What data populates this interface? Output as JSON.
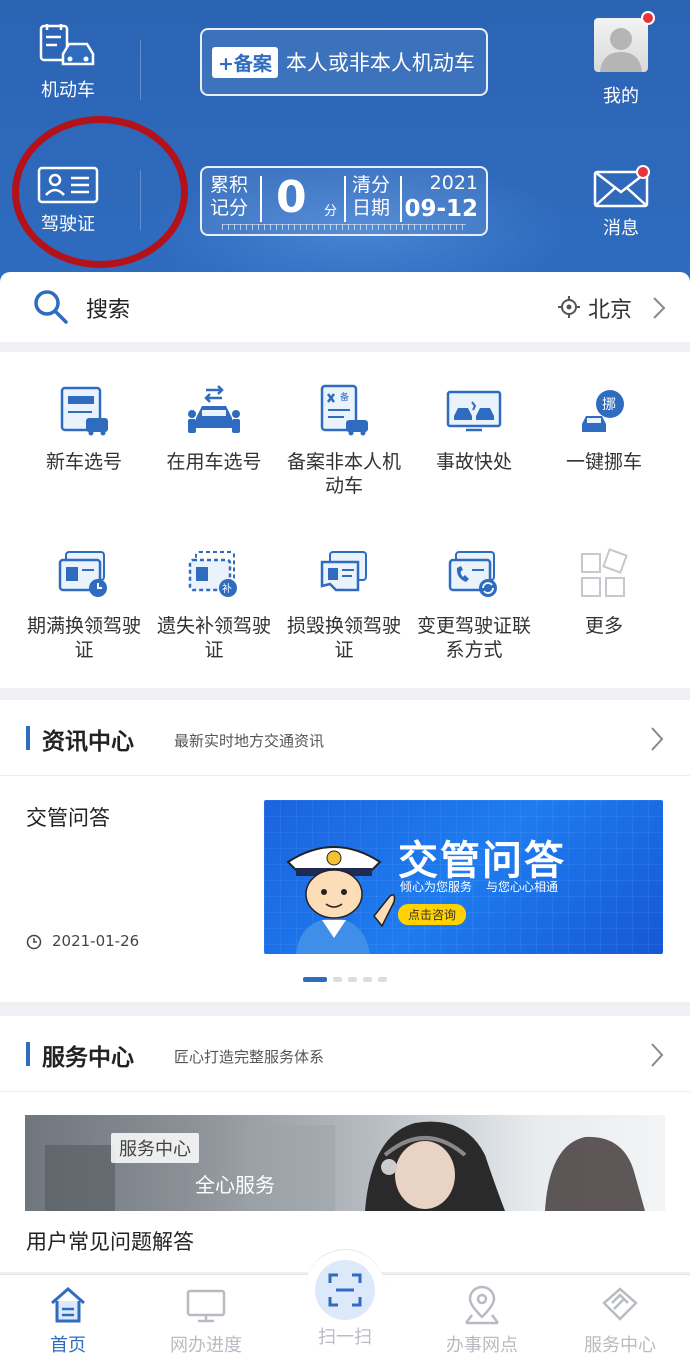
{
  "header": {
    "vehicle_label": "机动车",
    "license_label": "驾驶证",
    "plate_tag": "+备案",
    "plate_text": "本人或非本人机动车",
    "score_label": "累积记分",
    "score_value": "0",
    "score_unit": "分",
    "clear_label": "清分日期",
    "clear_year": "2021",
    "clear_date": "09-12",
    "mine_label": "我的",
    "message_label": "消息"
  },
  "search": {
    "label": "搜索",
    "city": "北京"
  },
  "services": [
    {
      "label": "新车选号",
      "icon": "new-car-plate-icon"
    },
    {
      "label": "在用车选号",
      "icon": "used-car-plate-icon"
    },
    {
      "label": "备案非本人机动车",
      "icon": "register-car-icon"
    },
    {
      "label": "事故快处",
      "icon": "accident-icon"
    },
    {
      "label": "一键挪车",
      "icon": "move-car-icon"
    },
    {
      "label": "期满换领驾驶证",
      "icon": "renew-license-icon"
    },
    {
      "label": "遗失补领驾驶证",
      "icon": "reissue-license-icon"
    },
    {
      "label": "损毁换领驾驶证",
      "icon": "replace-license-icon"
    },
    {
      "label": "变更驾驶证联系方式",
      "icon": "change-contact-icon"
    },
    {
      "label": "更多",
      "icon": "more-icon"
    }
  ],
  "news": {
    "title": "资讯中心",
    "subtitle": "最新实时地方交通资讯",
    "item_title": "交管问答",
    "item_date": "2021-01-26",
    "banner_title": "交管问答",
    "banner_sub1": "倾心为您服务",
    "banner_sub2": "与您心心相通",
    "banner_button": "点击咨询"
  },
  "center": {
    "title": "服务中心",
    "subtitle": "匠心打造完整服务体系",
    "photo_tag": "服务中心",
    "photo_slogan": "全心服务",
    "faq": "用户常见问题解答"
  },
  "tabs": [
    {
      "label": "首页",
      "active": true
    },
    {
      "label": "网办进度",
      "active": false
    },
    {
      "label": "扫一扫",
      "active": false
    },
    {
      "label": "办事网点",
      "active": false
    },
    {
      "label": "服务中心",
      "active": false
    }
  ],
  "colors": {
    "primary": "#2f6cc0",
    "header_bg": "#2c64b4",
    "badge_red": "#e8333a",
    "annotation_red": "#b3121b",
    "banner_yellow": "#ffd200"
  }
}
